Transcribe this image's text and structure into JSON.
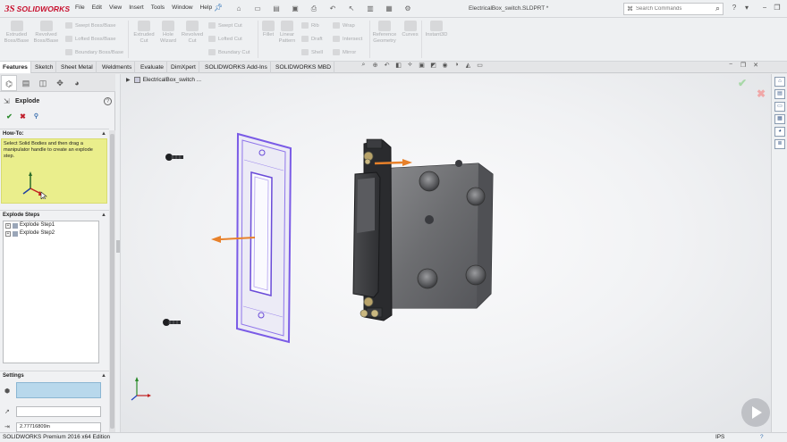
{
  "app": {
    "logo_mark": "3S",
    "logo_text": "SOLIDWORKS",
    "document_title": "ElectricalBox_switch.SLDPRT *"
  },
  "menu": [
    "File",
    "Edit",
    "View",
    "Insert",
    "Tools",
    "Window",
    "Help"
  ],
  "search": {
    "placeholder": "Search Commands"
  },
  "ribbon": {
    "extruded_boss": "Extruded\nBoss/Base",
    "revolved_boss": "Revolved\nBoss/Base",
    "swept_boss": "Swept Boss/Base",
    "lofted_boss": "Lofted Boss/Base",
    "boundary_boss": "Boundary Boss/Base",
    "extruded_cut": "Extruded\nCut",
    "hole_wizard": "Hole\nWizard",
    "revolved_cut": "Revolved\nCut",
    "swept_cut": "Swept Cut",
    "lofted_cut": "Lofted Cut",
    "boundary_cut": "Boundary Cut",
    "fillet": "Fillet",
    "linear_pattern": "Linear\nPattern",
    "rib": "Rib",
    "draft": "Draft",
    "shell": "Shell",
    "wrap": "Wrap",
    "intersect": "Intersect",
    "mirror": "Mirror",
    "reference_geometry": "Reference\nGeometry",
    "curves": "Curves",
    "instant3d": "Instant3D"
  },
  "tabs": [
    "Features",
    "Sketch",
    "Sheet Metal",
    "Weldments",
    "Evaluate",
    "DimXpert",
    "SOLIDWORKS Add-Ins",
    "SOLIDWORKS MBD"
  ],
  "active_tab": "Features",
  "panel": {
    "title": "Explode",
    "howto_header": "How-To:",
    "howto_text": "Select Solid Bodies and then drag a manipulator handle to create an explode step.",
    "steps_header": "Explode Steps",
    "steps": [
      "Explode Step1",
      "Explode Step2"
    ],
    "settings_header": "Settings",
    "distance_value": "2.77716809in"
  },
  "viewport": {
    "tree_label": "ElectricalBox_switch ..."
  },
  "status": {
    "left": "SOLIDWORKS Premium 2016 x64 Edition",
    "units": "IPS",
    "help": "?"
  },
  "colors": {
    "brand": "#c8102e",
    "howto_bg": "#eaee8c",
    "selection_field": "#b8d8ec",
    "cover_plate_highlight": "#7a5be6",
    "drag_arrow": "#e8812a"
  }
}
